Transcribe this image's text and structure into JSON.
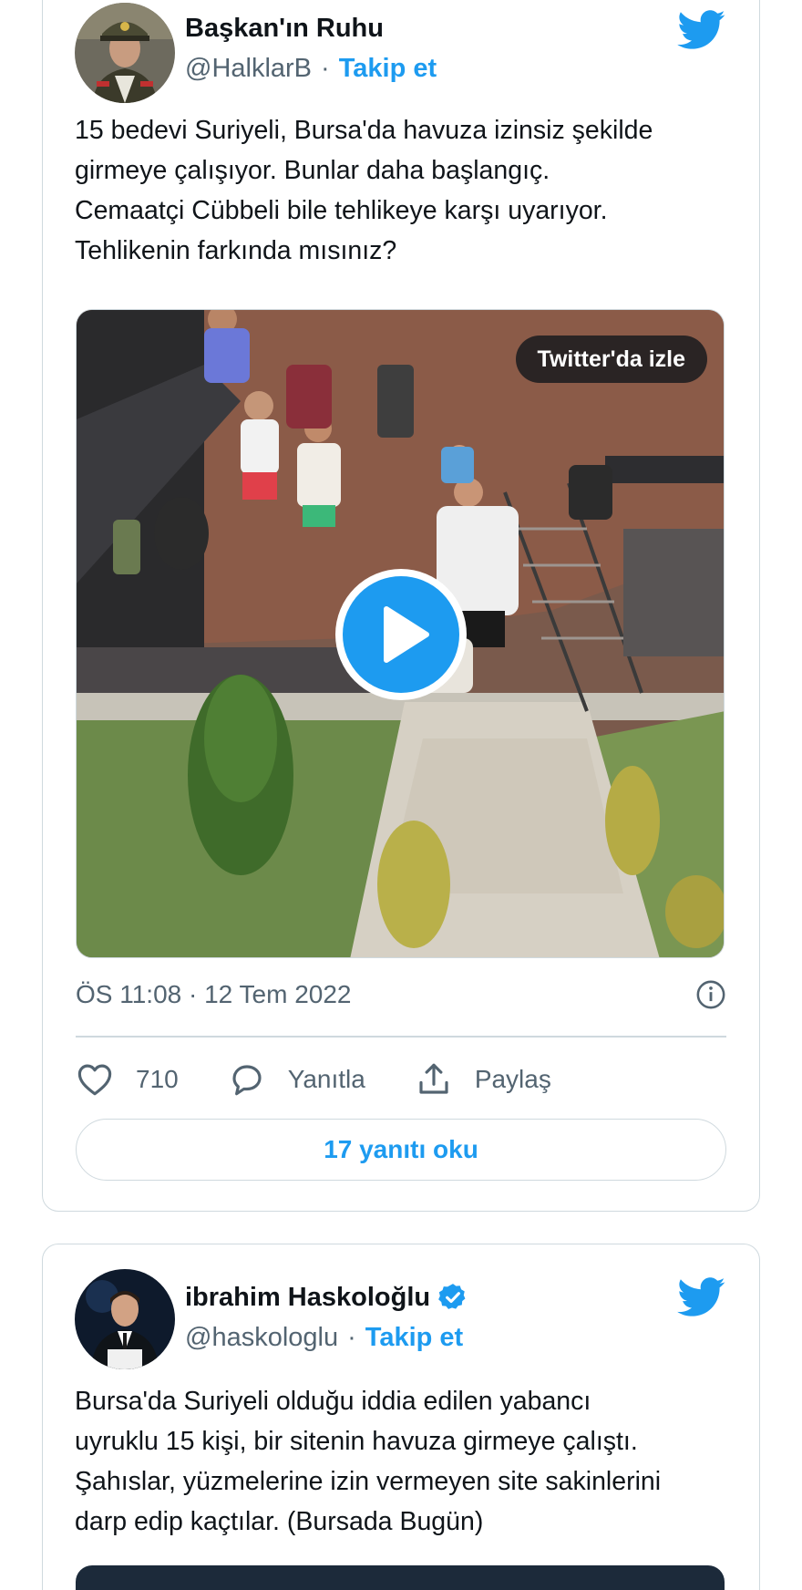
{
  "tweets": [
    {
      "display_name": "Başkan'ın Ruhu",
      "handle": "@HalklarB",
      "follow_label": "Takip et",
      "verified": false,
      "text_lines": [
        "15 bedevi Suriyeli,  Bursa'da havuza izinsiz şekilde",
        "girmeye çalışıyor. Bunlar daha başlangıç.",
        "Cemaatçi Cübbeli bile tehlikeye karşı uyarıyor.",
        "Tehlikenin farkında mısınız?"
      ],
      "media": {
        "watch_label": "Twitter'da izle",
        "icon": "play-icon"
      },
      "timestamp": "ÖS 11:08 · 12 Tem 2022",
      "likes": "710",
      "reply_label": "Yanıtla",
      "share_label": "Paylaş",
      "read_replies": "17 yanıtı oku"
    },
    {
      "display_name": "ibrahim Haskoloğlu",
      "handle": "@haskologlu",
      "follow_label": "Takip et",
      "verified": true,
      "text_lines": [
        "Bursa'da Suriyeli olduğu iddia edilen yabancı",
        "uyruklu 15 kişi, bir sitenin havuza girmeye çalıştı.",
        "Şahıslar, yüzmelerine izin vermeyen site sakinlerini",
        "darp edip kaçtılar. (Bursada Bugün)"
      ]
    }
  ],
  "colors": {
    "twitter_blue": "#1d9bf0",
    "text_primary": "#0f1419",
    "text_secondary": "#536471",
    "border": "#cfd9de"
  },
  "icons": [
    "twitter-bird-icon",
    "verified-badge-icon",
    "play-icon",
    "info-icon",
    "heart-icon",
    "reply-icon",
    "share-icon"
  ]
}
